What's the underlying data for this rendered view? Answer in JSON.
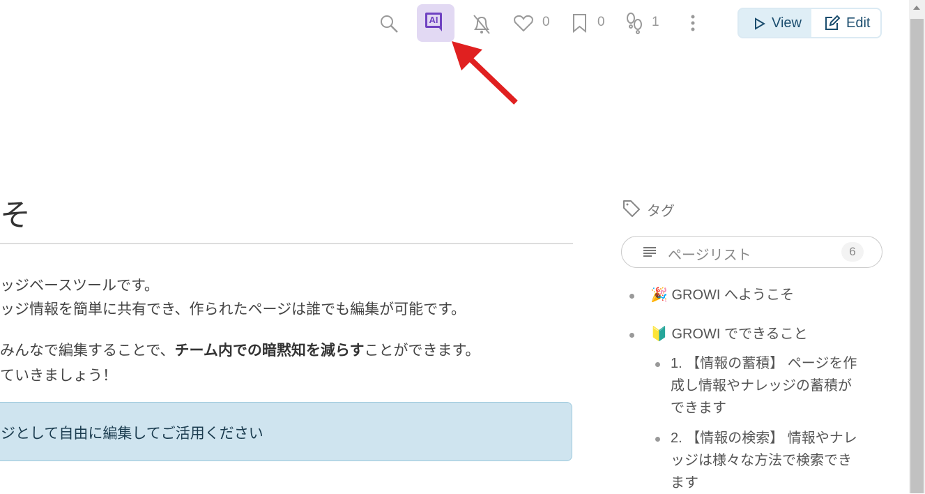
{
  "toolbar": {
    "like_count": "0",
    "bookmark_count": "0",
    "seen_count": "1",
    "view_label": "View",
    "edit_label": "Edit",
    "ai_label": "AI"
  },
  "page": {
    "title_fragment": "そ",
    "line1": "ッジベースツールです。",
    "line2": "ッジ情報を簡単に共有でき、作られたページは誰でも編集が可能です。",
    "line3_pre": "みんなで編集することで、",
    "line3_bold": "チーム内での暗黙知を減らす",
    "line3_post": "ことができます。",
    "line4": "ていきましょう！",
    "alert": "ジとして自由に編集してご活用ください"
  },
  "sidebar": {
    "tag_label": "タグ",
    "pagelist_label": "ページリスト",
    "pagelist_count": "6",
    "items": [
      {
        "emoji": "🎉",
        "label": "GROWI へようこそ"
      },
      {
        "emoji": "🔰",
        "label": "GROWI でできること"
      }
    ],
    "subitems": [
      "1. 【情報の蓄積】 ページを作成し情報やナレッジの蓄積ができます",
      "2. 【情報の検索】 情報やナレッジは様々な方法で検索できます"
    ]
  },
  "colors": {
    "ai_bg": "#e2d9f3",
    "ai_fg": "#6f42c1",
    "arrow": "#e02020",
    "alert_bg": "#cfe4ef"
  }
}
